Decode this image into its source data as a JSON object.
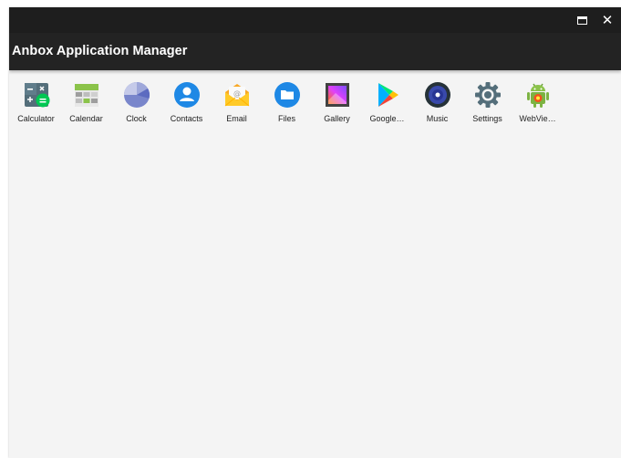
{
  "window": {
    "controls": {
      "restore_icon": "window-restore-icon",
      "close_glyph": "✕"
    }
  },
  "appbar": {
    "title": "Anbox Application Manager"
  },
  "apps": [
    {
      "label": "Calculator",
      "icon": "calculator-icon"
    },
    {
      "label": "Calendar",
      "icon": "calendar-icon"
    },
    {
      "label": "Clock",
      "icon": "clock-icon"
    },
    {
      "label": "Contacts",
      "icon": "contacts-icon"
    },
    {
      "label": "Email",
      "icon": "email-icon"
    },
    {
      "label": "Files",
      "icon": "files-icon"
    },
    {
      "label": "Gallery",
      "icon": "gallery-icon"
    },
    {
      "label": "Google…",
      "icon": "google-play-icon"
    },
    {
      "label": "Music",
      "icon": "music-icon"
    },
    {
      "label": "Settings",
      "icon": "settings-icon"
    },
    {
      "label": "WebVie…",
      "icon": "android-webview-icon"
    }
  ],
  "colors": {
    "titlebar": "#1e1e1e",
    "appbar": "#232323",
    "content_background": "#f4f4f4",
    "accent_blue": "#1e88e5"
  }
}
